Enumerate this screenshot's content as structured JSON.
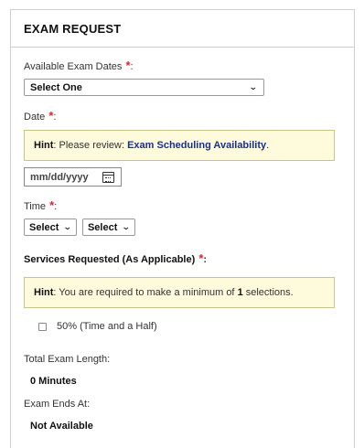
{
  "panel": {
    "title": "EXAM REQUEST"
  },
  "available_dates": {
    "label": "Available Exam Dates",
    "required_mark": "*",
    "colon": ":",
    "selected": "Select One"
  },
  "date": {
    "label": "Date",
    "required_mark": "*",
    "colon": ":",
    "hint_prefix": "Hint",
    "hint_text": ": Please review: ",
    "hint_link": "Exam Scheduling Availability",
    "hint_suffix": ".",
    "placeholder": "mm/dd/yyyy"
  },
  "time": {
    "label": "Time",
    "required_mark": "*",
    "colon": ":",
    "hour_selected": "Select",
    "minute_selected": "Select"
  },
  "services": {
    "label": "Services Requested (As Applicable)",
    "required_mark": "*",
    "colon": ":",
    "hint_prefix": "Hint",
    "hint_text": ": You are required to make a minimum of ",
    "hint_count": "1",
    "hint_suffix": " selections.",
    "options": [
      {
        "label": "50% (Time and a Half)",
        "checked": false
      }
    ]
  },
  "total_length": {
    "label": "Total Exam Length:",
    "value": "0 Minutes"
  },
  "ends_at": {
    "label": "Exam Ends At:",
    "value": "Not Available"
  },
  "colors": {
    "required": "#d9262b",
    "hint_bg": "#fdfbdc",
    "hint_border": "#c9c38a",
    "link": "#1b2f91"
  },
  "icons": {
    "dropdown": "chevron-down-icon",
    "calendar": "calendar-icon"
  }
}
